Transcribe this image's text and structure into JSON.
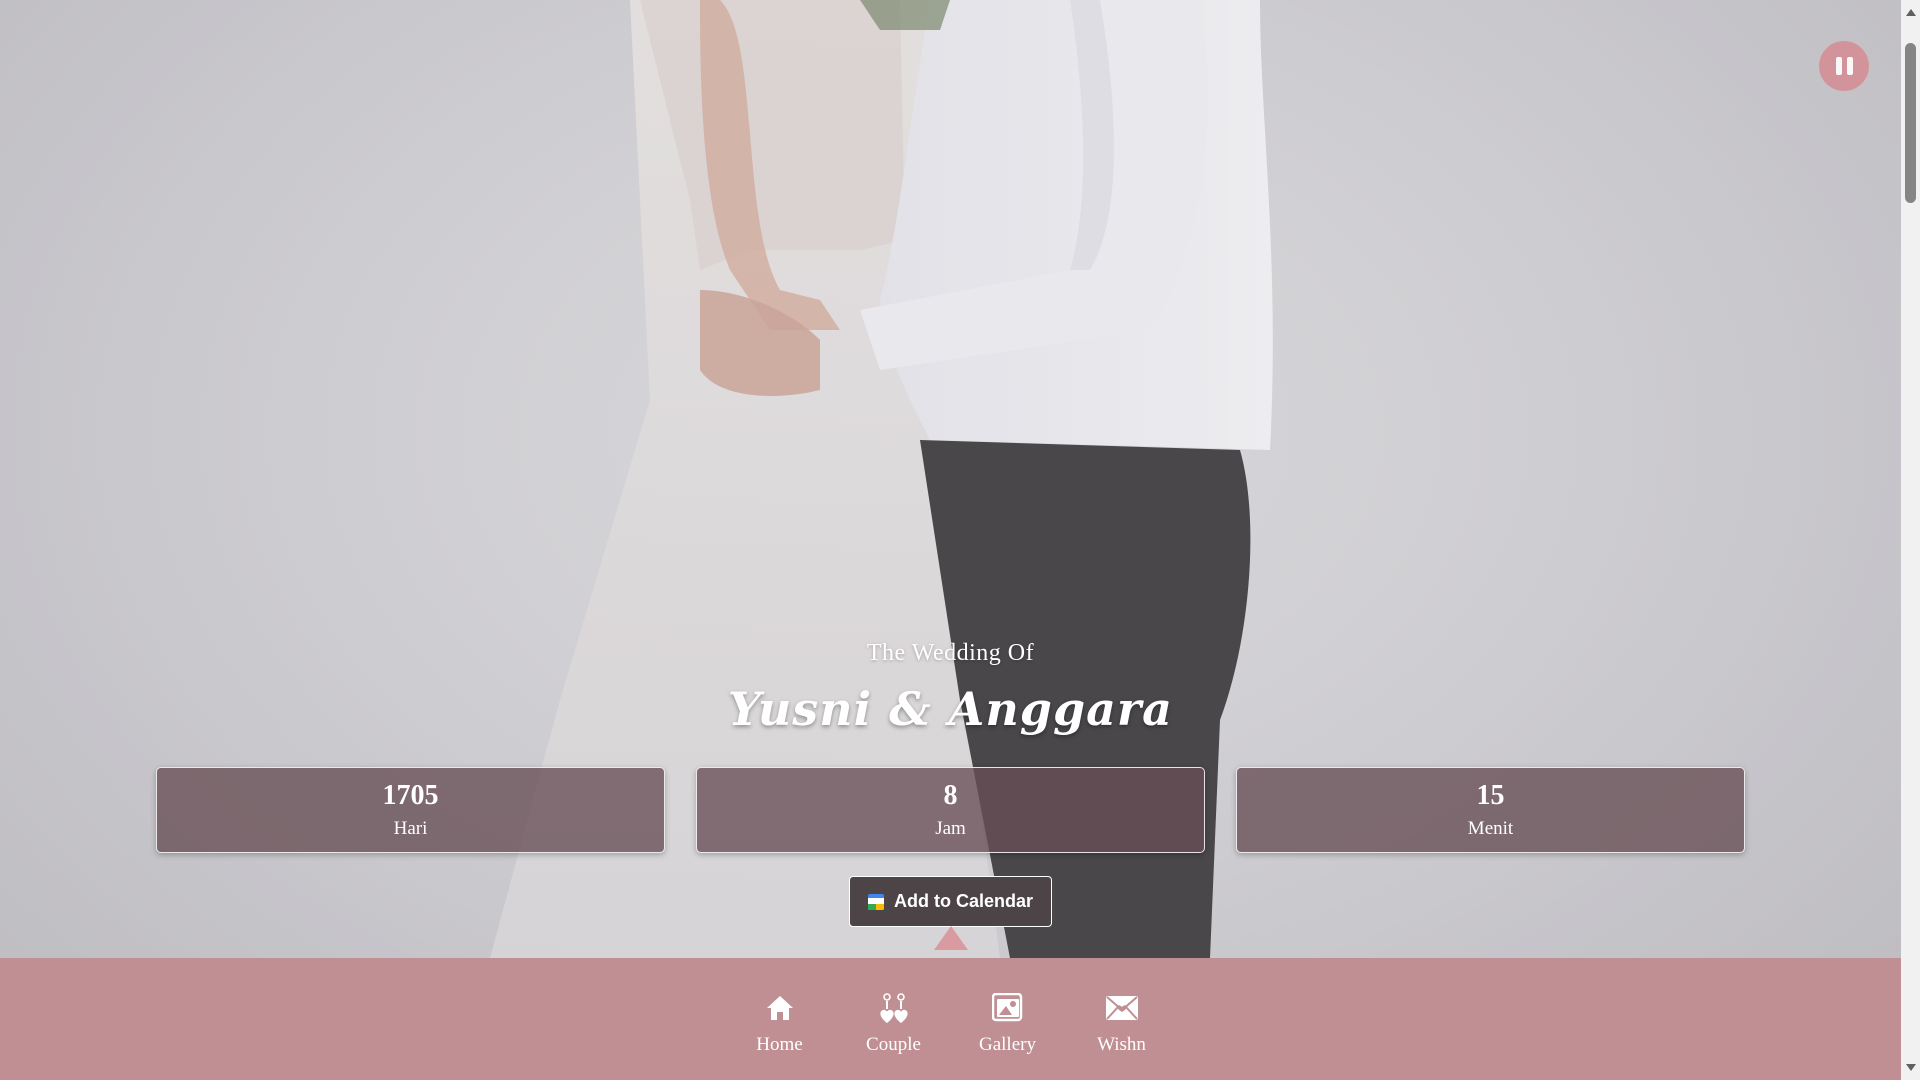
{
  "hero": {
    "subtitle": "The Wedding Of",
    "names": "Yusni & Anggara"
  },
  "countdown": [
    {
      "value": "1705",
      "label": "Hari"
    },
    {
      "value": "8",
      "label": "Jam"
    },
    {
      "value": "15",
      "label": "Menit"
    }
  ],
  "calendar_button": {
    "label": "Add to Calendar"
  },
  "nav": [
    {
      "label": "Home",
      "icon": "home-icon"
    },
    {
      "label": "Couple",
      "icon": "couple-icon"
    },
    {
      "label": "Gallery",
      "icon": "gallery-icon"
    },
    {
      "label": "Wishn",
      "icon": "envelope-icon"
    }
  ],
  "colors": {
    "nav_background": "#bf8f93",
    "music_button": "#d49096",
    "count_box": "#664e54"
  }
}
